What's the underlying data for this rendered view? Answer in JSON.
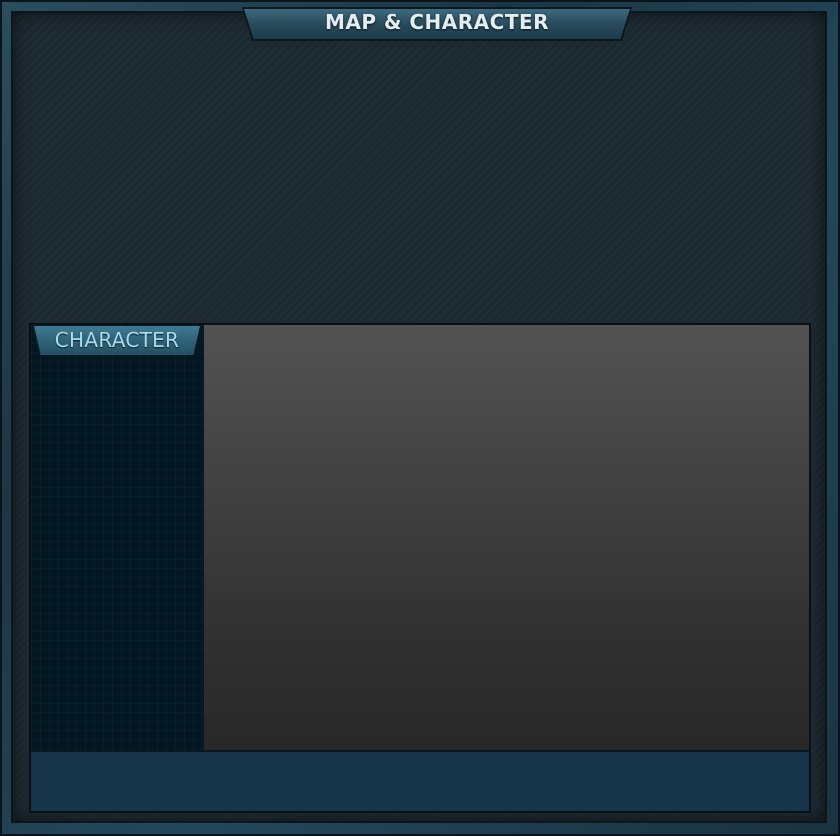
{
  "window": {
    "title": "MAP & CHARACTER"
  },
  "character_panel": {
    "tab_label": "CHARACTER"
  },
  "colors": {
    "frame_accent": "#2a4e5e",
    "panel_background": "#1d2931",
    "tab_text": "#a9dcef",
    "footer": "#16344a"
  }
}
